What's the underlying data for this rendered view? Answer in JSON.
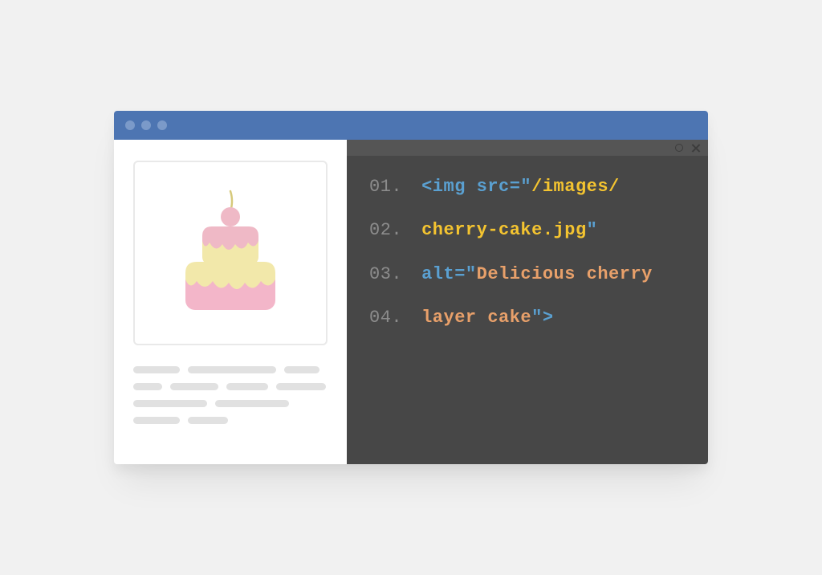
{
  "code": {
    "lines": [
      {
        "num": "01.",
        "parts": [
          {
            "cls": "t-blue",
            "text": "<img src=\""
          },
          {
            "cls": "t-yellow",
            "text": "/images/"
          }
        ]
      },
      {
        "num": "02.",
        "parts": [
          {
            "cls": "t-yellow",
            "text": "cherry-cake.jpg"
          },
          {
            "cls": "t-blue",
            "text": "\""
          }
        ]
      },
      {
        "num": "03.",
        "parts": [
          {
            "cls": "t-blue",
            "text": "alt=\""
          },
          {
            "cls": "t-orange",
            "text": "Delicious cherry"
          }
        ]
      },
      {
        "num": "04.",
        "parts": [
          {
            "cls": "t-orange",
            "text": "layer cake"
          },
          {
            "cls": "t-blue",
            "text": "\">"
          }
        ]
      }
    ]
  }
}
